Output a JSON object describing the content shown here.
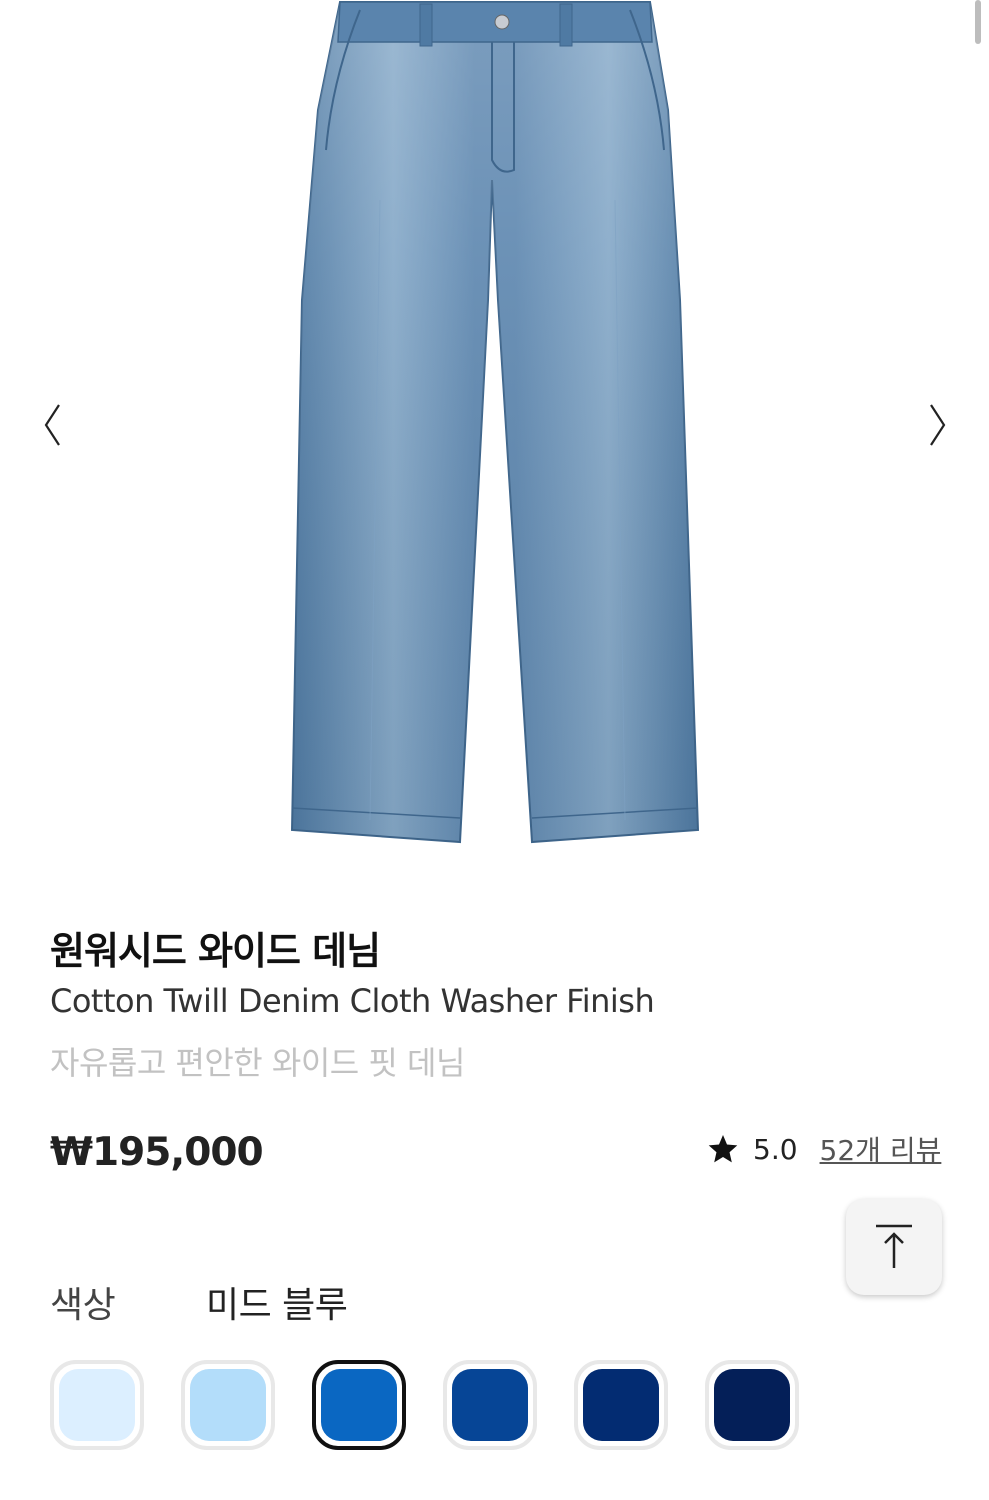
{
  "product": {
    "title": "원워시드 와이드 데님",
    "subtitle": "Cotton Twill Denim Cloth Washer Finish",
    "tagline": "자유롭고 편안한 와이드 핏 데님",
    "price": "₩195,000",
    "rating": "5.0",
    "reviews_label": "52개 리뷰"
  },
  "icons": {
    "prev": "chevron-left-icon",
    "next": "chevron-right-icon",
    "star": "star-icon",
    "top": "arrow-up-to-top-icon"
  },
  "color": {
    "label": "색상",
    "selected_name": "미드 블루",
    "swatches": [
      {
        "hex": "#dcefff",
        "selected": false
      },
      {
        "hex": "#b3ddfa",
        "selected": false
      },
      {
        "hex": "#0a67c2",
        "selected": true
      },
      {
        "hex": "#064596",
        "selected": false
      },
      {
        "hex": "#032c72",
        "selected": false
      },
      {
        "hex": "#041f58",
        "selected": false
      }
    ]
  },
  "colors": {
    "denim_base": "#6a93b9",
    "denim_light": "#9ebcd5",
    "denim_dark": "#4a739a"
  }
}
